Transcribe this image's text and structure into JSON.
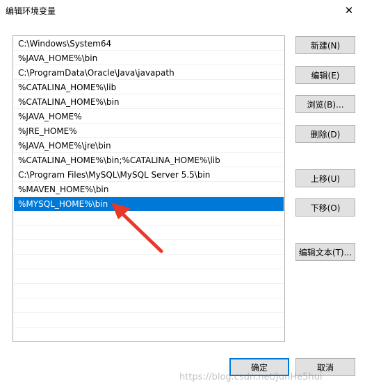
{
  "window": {
    "title": "编辑环境变量",
    "close_glyph": "✕"
  },
  "list": {
    "items": [
      "C:\\Windows\\System64",
      "%JAVA_HOME%\\bin",
      "C:\\ProgramData\\Oracle\\Java\\javapath",
      "%CATALINA_HOME%\\lib",
      "%CATALINA_HOME%\\bin",
      "%JAVA_HOME%",
      "%JRE_HOME%",
      "%JAVA_HOME%\\jre\\bin",
      "%CATALINA_HOME%\\bin;%CATALINA_HOME%\\lib",
      "C:\\Program Files\\MySQL\\MySQL Server 5.5\\bin",
      "%MAVEN_HOME%\\bin",
      "%MYSQL_HOME%\\bin"
    ],
    "selected_index": 11
  },
  "buttons": {
    "new": "新建(N)",
    "edit": "编辑(E)",
    "browse": "浏览(B)...",
    "delete": "删除(D)",
    "move_up": "上移(U)",
    "move_down": "下移(O)",
    "edit_text": "编辑文本(T)...",
    "ok": "确定",
    "cancel": "取消"
  },
  "annotation": {
    "arrow_color": "#e8382a",
    "points_to": "%MYSQL_HOME%\\bin"
  },
  "watermark": "https://blog.csdn.net/JunHe5hui",
  "colors": {
    "selection": "#0078d7",
    "button_face": "#e1e1e1",
    "button_border": "#adadad"
  }
}
